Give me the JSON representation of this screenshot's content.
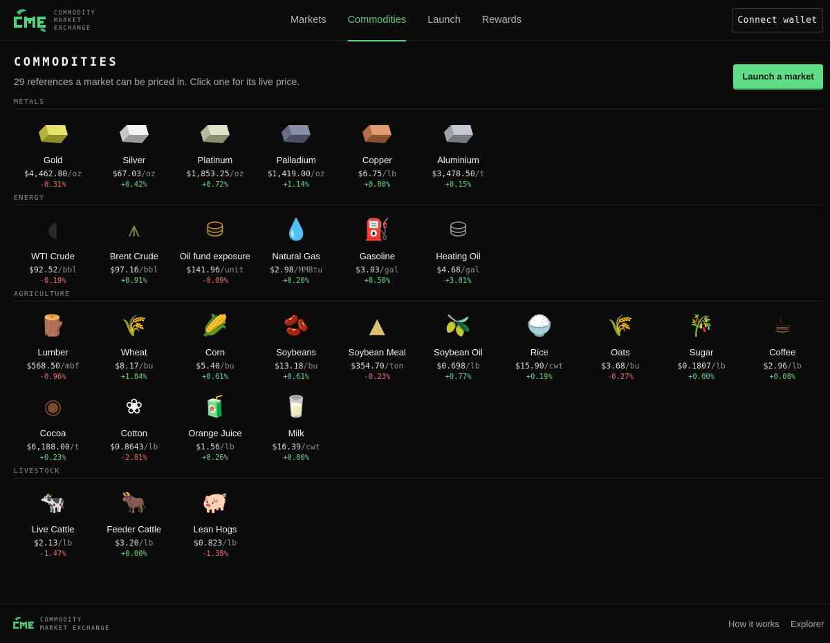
{
  "header": {
    "brand_lines": [
      "COMMODITY",
      "MARKET",
      "EXCHANGE"
    ],
    "nav": [
      {
        "label": "Markets",
        "active": false
      },
      {
        "label": "Commodities",
        "active": true
      },
      {
        "label": "Launch",
        "active": false
      },
      {
        "label": "Rewards",
        "active": false
      }
    ],
    "connect_label": "Connect wallet"
  },
  "page": {
    "title": "COMMODITIES",
    "subtitle": "29 references a market can be priced in. Click one for its live price.",
    "launch_label": "Launch a market"
  },
  "colors": {
    "accent": "#4fd37d",
    "up": "#5fd687",
    "down": "#ef6a6a"
  },
  "sections": [
    {
      "label": "METALS",
      "items": [
        {
          "name": "Gold",
          "price": "$4,462.80",
          "unit": "/oz",
          "change": "-0.31%",
          "icon": "gold-bar-icon"
        },
        {
          "name": "Silver",
          "price": "$67.03",
          "unit": "/oz",
          "change": "+0.42%",
          "icon": "silver-bar-icon"
        },
        {
          "name": "Platinum",
          "price": "$1,853.25",
          "unit": "/oz",
          "change": "+0.72%",
          "icon": "platinum-bar-icon"
        },
        {
          "name": "Palladium",
          "price": "$1,419.00",
          "unit": "/oz",
          "change": "+1.14%",
          "icon": "palladium-bar-icon"
        },
        {
          "name": "Copper",
          "price": "$6.75",
          "unit": "/lb",
          "change": "+0.80%",
          "icon": "copper-bar-icon"
        },
        {
          "name": "Aluminium",
          "price": "$3,478.50",
          "unit": "/t",
          "change": "+0.15%",
          "icon": "aluminium-bar-icon"
        }
      ]
    },
    {
      "label": "ENERGY",
      "items": [
        {
          "name": "WTI Crude",
          "price": "$92.52",
          "unit": "/bbl",
          "change": "-0.19%",
          "icon": "oil-drop-icon"
        },
        {
          "name": "Brent Crude",
          "price": "$97.16",
          "unit": "/bbl",
          "change": "+0.91%",
          "icon": "oil-rig-icon"
        },
        {
          "name": "Oil fund exposure",
          "price": "$141.96",
          "unit": "/unit",
          "change": "-0.09%",
          "icon": "oil-barrel-icon"
        },
        {
          "name": "Natural Gas",
          "price": "$2.98",
          "unit": "/MMBtu",
          "change": "+0.20%",
          "icon": "gas-drop-icon"
        },
        {
          "name": "Gasoline",
          "price": "$3.03",
          "unit": "/gal",
          "change": "+0.50%",
          "icon": "fuel-pump-icon"
        },
        {
          "name": "Heating Oil",
          "price": "$4.68",
          "unit": "/gal",
          "change": "+3.01%",
          "icon": "oil-tank-icon"
        }
      ]
    },
    {
      "label": "AGRICULTURE",
      "items": [
        {
          "name": "Lumber",
          "price": "$568.50",
          "unit": "/mbf",
          "change": "-0.96%",
          "icon": "lumber-icon"
        },
        {
          "name": "Wheat",
          "price": "$8.17",
          "unit": "/bu",
          "change": "+1.84%",
          "icon": "wheat-icon"
        },
        {
          "name": "Corn",
          "price": "$5.40",
          "unit": "/bu",
          "change": "+0.61%",
          "icon": "corn-icon"
        },
        {
          "name": "Soybeans",
          "price": "$13.18",
          "unit": "/bu",
          "change": "+0.61%",
          "icon": "soybeans-icon"
        },
        {
          "name": "Soybean Meal",
          "price": "$354.70",
          "unit": "/ton",
          "change": "-0.23%",
          "icon": "soybean-meal-icon"
        },
        {
          "name": "Soybean Oil",
          "price": "$0.698",
          "unit": "/lb",
          "change": "+0.77%",
          "icon": "olive-oil-icon"
        },
        {
          "name": "Rice",
          "price": "$15.90",
          "unit": "/cwt",
          "change": "+0.19%",
          "icon": "rice-bowl-icon"
        },
        {
          "name": "Oats",
          "price": "$3.68",
          "unit": "/bu",
          "change": "-0.27%",
          "icon": "oats-icon"
        },
        {
          "name": "Sugar",
          "price": "$0.1807",
          "unit": "/lb",
          "change": "+0.00%",
          "icon": "sugarcane-icon"
        },
        {
          "name": "Coffee",
          "price": "$2.96",
          "unit": "/lb",
          "change": "+0.08%",
          "icon": "coffee-bean-icon"
        },
        {
          "name": "Cocoa",
          "price": "$6,188.00",
          "unit": "/t",
          "change": "+0.23%",
          "icon": "cocoa-bean-icon"
        },
        {
          "name": "Cotton",
          "price": "$0.8643",
          "unit": "/lb",
          "change": "-2.81%",
          "icon": "cotton-icon"
        },
        {
          "name": "Orange Juice",
          "price": "$1.56",
          "unit": "/lb",
          "change": "+0.26%",
          "icon": "orange-juice-icon"
        },
        {
          "name": "Milk",
          "price": "$16.39",
          "unit": "/cwt",
          "change": "+0.00%",
          "icon": "milk-glass-icon"
        }
      ]
    },
    {
      "label": "LIVESTOCK",
      "items": [
        {
          "name": "Live Cattle",
          "price": "$2.13",
          "unit": "/lb",
          "change": "-1.47%",
          "icon": "cow-icon"
        },
        {
          "name": "Feeder Cattle",
          "price": "$3.20",
          "unit": "/lb",
          "change": "+0.00%",
          "icon": "ox-icon"
        },
        {
          "name": "Lean Hogs",
          "price": "$0.823",
          "unit": "/lb",
          "change": "-1.38%",
          "icon": "pig-icon"
        }
      ]
    }
  ],
  "footer": {
    "brand_lines": [
      "COMMODITY",
      "MARKET EXCHANGE"
    ],
    "links": [
      "How it works",
      "Explorer"
    ]
  }
}
